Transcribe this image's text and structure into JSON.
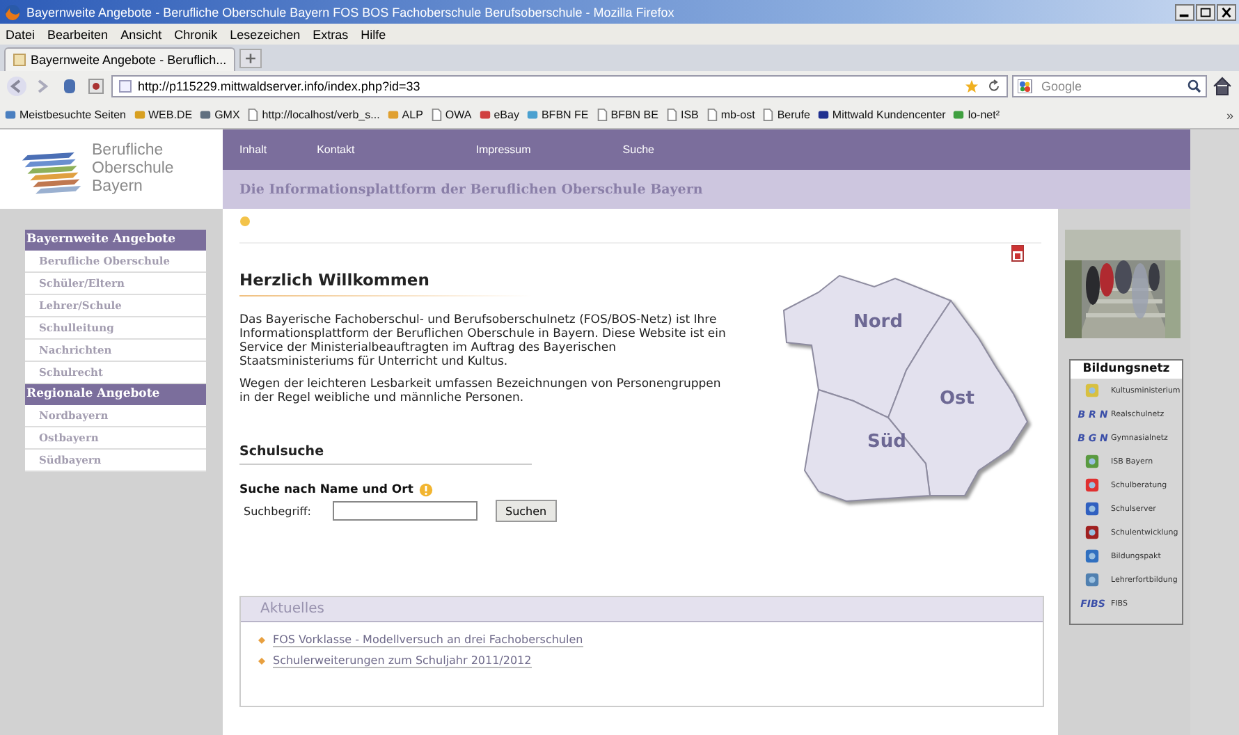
{
  "window": {
    "title": "Bayernweite Angebote - Berufliche Oberschule Bayern FOS BOS Fachoberschule Berufsoberschule - Mozilla Firefox"
  },
  "menu": [
    "Datei",
    "Bearbeiten",
    "Ansicht",
    "Chronik",
    "Lesezeichen",
    "Extras",
    "Hilfe"
  ],
  "tabs": [
    {
      "label": "Bayernweite Angebote - Beruflich...",
      "selected": true
    }
  ],
  "address": {
    "url": "http://p115229.mittwaldserver.info/index.php?id=33"
  },
  "search": {
    "placeholder": "Google"
  },
  "bookmarks": [
    {
      "label": "Meistbesuchte Seiten",
      "kind": "site"
    },
    {
      "label": "WEB.DE",
      "kind": "site"
    },
    {
      "label": "GMX",
      "kind": "site"
    },
    {
      "label": "http://localhost/verb_s...",
      "kind": "page"
    },
    {
      "label": "ALP",
      "kind": "site"
    },
    {
      "label": "OWA",
      "kind": "page"
    },
    {
      "label": "eBay",
      "kind": "site"
    },
    {
      "label": "BFBN FE",
      "kind": "site"
    },
    {
      "label": "BFBN BE",
      "kind": "page"
    },
    {
      "label": "ISB",
      "kind": "page"
    },
    {
      "label": "mb-ost",
      "kind": "page"
    },
    {
      "label": "Berufe",
      "kind": "page"
    },
    {
      "label": "Mittwald Kundencenter",
      "kind": "site"
    },
    {
      "label": "lo-net²",
      "kind": "site"
    }
  ],
  "bookmarks_more": "»",
  "logo": {
    "lines": [
      "Berufliche",
      "Oberschule",
      "Bayern"
    ]
  },
  "top_nav": [
    "Inhalt",
    "Kontakt",
    "Impressum",
    "Suche"
  ],
  "subtitle": "Die Informationsplattform der Beruflichen Oberschule Bayern",
  "sidebar": [
    {
      "heading": "Bayernweite Angebote",
      "items": [
        "Berufliche Oberschule",
        "Schüler/Eltern",
        "Lehrer/Schule",
        "Schulleitung",
        "Nachrichten",
        "Schulrecht"
      ]
    },
    {
      "heading": "Regionale Angebote",
      "items": [
        "Nordbayern",
        "Ostbayern",
        "Südbayern"
      ]
    }
  ],
  "welcome": {
    "heading": "Herzlich Willkommen",
    "paragraphs": [
      "Das Bayerische Fachoberschul- und Berufsoberschulnetz (FOS/BOS-Netz) ist Ihre Informationsplattform der Beruflichen Oberschule in Bayern. Diese Website ist ein Service der Ministerialbeauftragten im Auftrag des Bayerischen Staatsministeriums für Unterricht und Kultus.",
      "Wegen der leichteren Lesbarkeit umfassen Bezeichnungen von Personengruppen in der Regel weibliche und männliche Personen."
    ]
  },
  "map": {
    "regions": [
      {
        "label": "Nord"
      },
      {
        "label": "Ost"
      },
      {
        "label": "Süd"
      }
    ]
  },
  "school_search": {
    "heading": "Schulsuche",
    "subheading": "Suche nach Name und Ort",
    "field_label": "Suchbegriff:",
    "button": "Suchen"
  },
  "news": {
    "heading": "Aktuelles",
    "items": [
      "FOS Vorklasse - Modellversuch an drei Fachoberschulen",
      "Schulerweiterungen zum Schuljahr 2011/2012"
    ]
  },
  "bildungsnetz": {
    "heading": "Bildungsnetz",
    "links": [
      {
        "label": "Kultusministerium",
        "kind": "icon"
      },
      {
        "label": "Realschulnetz",
        "kind": "text-logo",
        "logo": "B R N"
      },
      {
        "label": "Gymnasialnetz",
        "kind": "text-logo",
        "logo": "B G N"
      },
      {
        "label": "ISB Bayern",
        "kind": "icon"
      },
      {
        "label": "Schulberatung",
        "kind": "icon"
      },
      {
        "label": "Schulserver",
        "kind": "icon"
      },
      {
        "label": "Schulentwicklung",
        "kind": "icon"
      },
      {
        "label": "Bildungspakt",
        "kind": "icon"
      },
      {
        "label": "Lehrerfortbildung",
        "kind": "icon"
      },
      {
        "label": "FIBS",
        "kind": "text-logo",
        "logo": "FIBS"
      }
    ]
  }
}
